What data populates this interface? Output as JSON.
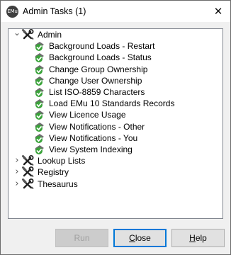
{
  "window": {
    "title": "Admin Tasks (1)",
    "app_icon_text": "EMu",
    "close_glyph": "✕"
  },
  "tree": {
    "nodes": [
      {
        "label": "Admin",
        "expanded": true,
        "icon": "tools-icon",
        "children": [
          {
            "label": "Background Loads - Restart",
            "icon": "task-check-icon"
          },
          {
            "label": "Background Loads - Status",
            "icon": "task-check-icon"
          },
          {
            "label": "Change Group Ownership",
            "icon": "task-check-icon"
          },
          {
            "label": "Change User Ownership",
            "icon": "task-check-icon"
          },
          {
            "label": "List ISO-8859 Characters",
            "icon": "task-check-icon"
          },
          {
            "label": "Load EMu 10 Standards Records",
            "icon": "task-check-icon"
          },
          {
            "label": "View Licence Usage",
            "icon": "task-check-icon"
          },
          {
            "label": "View Notifications - Other",
            "icon": "task-check-icon"
          },
          {
            "label": "View Notifications - You",
            "icon": "task-check-icon"
          },
          {
            "label": "View System Indexing",
            "icon": "task-check-icon"
          }
        ]
      },
      {
        "label": "Lookup Lists",
        "expanded": false,
        "icon": "tools-icon"
      },
      {
        "label": "Registry",
        "expanded": false,
        "icon": "tools-icon"
      },
      {
        "label": "Thesaurus",
        "expanded": false,
        "icon": "tools-icon"
      }
    ]
  },
  "buttons": {
    "run": {
      "label": "Run",
      "enabled": false
    },
    "close": {
      "label_underlined": "C",
      "label_rest": "lose",
      "enabled": true
    },
    "help": {
      "label_underlined": "H",
      "label_rest": "elp",
      "enabled": true
    }
  }
}
